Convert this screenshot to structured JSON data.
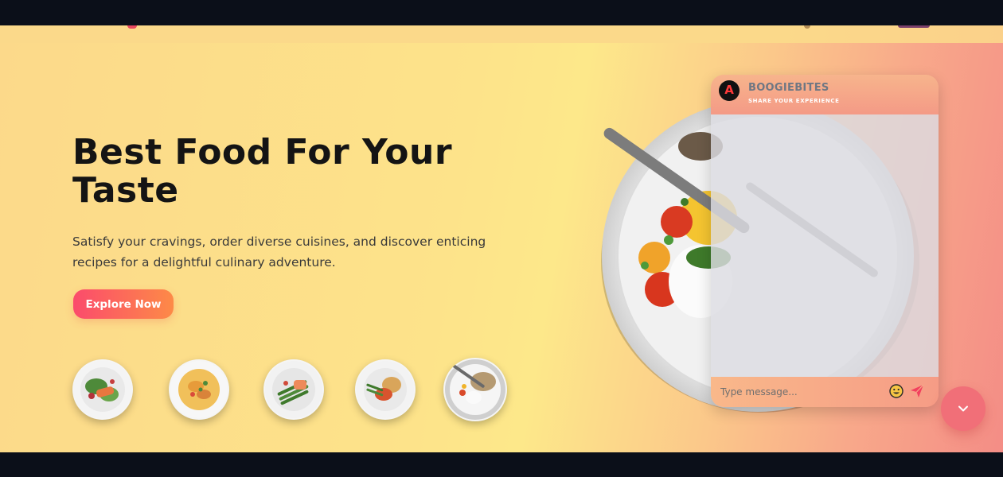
{
  "hero": {
    "title": "Best Food For Your Taste",
    "subtitle": "Satisfy your cravings, order diverse cuisines, and discover enticing recipes for a delightful culinary adventure.",
    "cta_label": "Explore Now"
  },
  "thumbnails": [
    {
      "icon": "salmon-salad-icon"
    },
    {
      "icon": "pasta-plate-icon"
    },
    {
      "icon": "asparagus-salmon-icon"
    },
    {
      "icon": "rice-chicken-icon"
    },
    {
      "icon": "egg-toast-plate-icon"
    }
  ],
  "chat": {
    "logo_letter": "A",
    "brand": "BOOGIEBITES",
    "tagline": "SHARE YOUR EXPERIENCE",
    "input_placeholder": "Type message..."
  },
  "colors": {
    "accent_start": "#fb4b6c",
    "accent_end": "#fd8a47",
    "fab": "#f16f78",
    "dark": "#0b0f19"
  }
}
